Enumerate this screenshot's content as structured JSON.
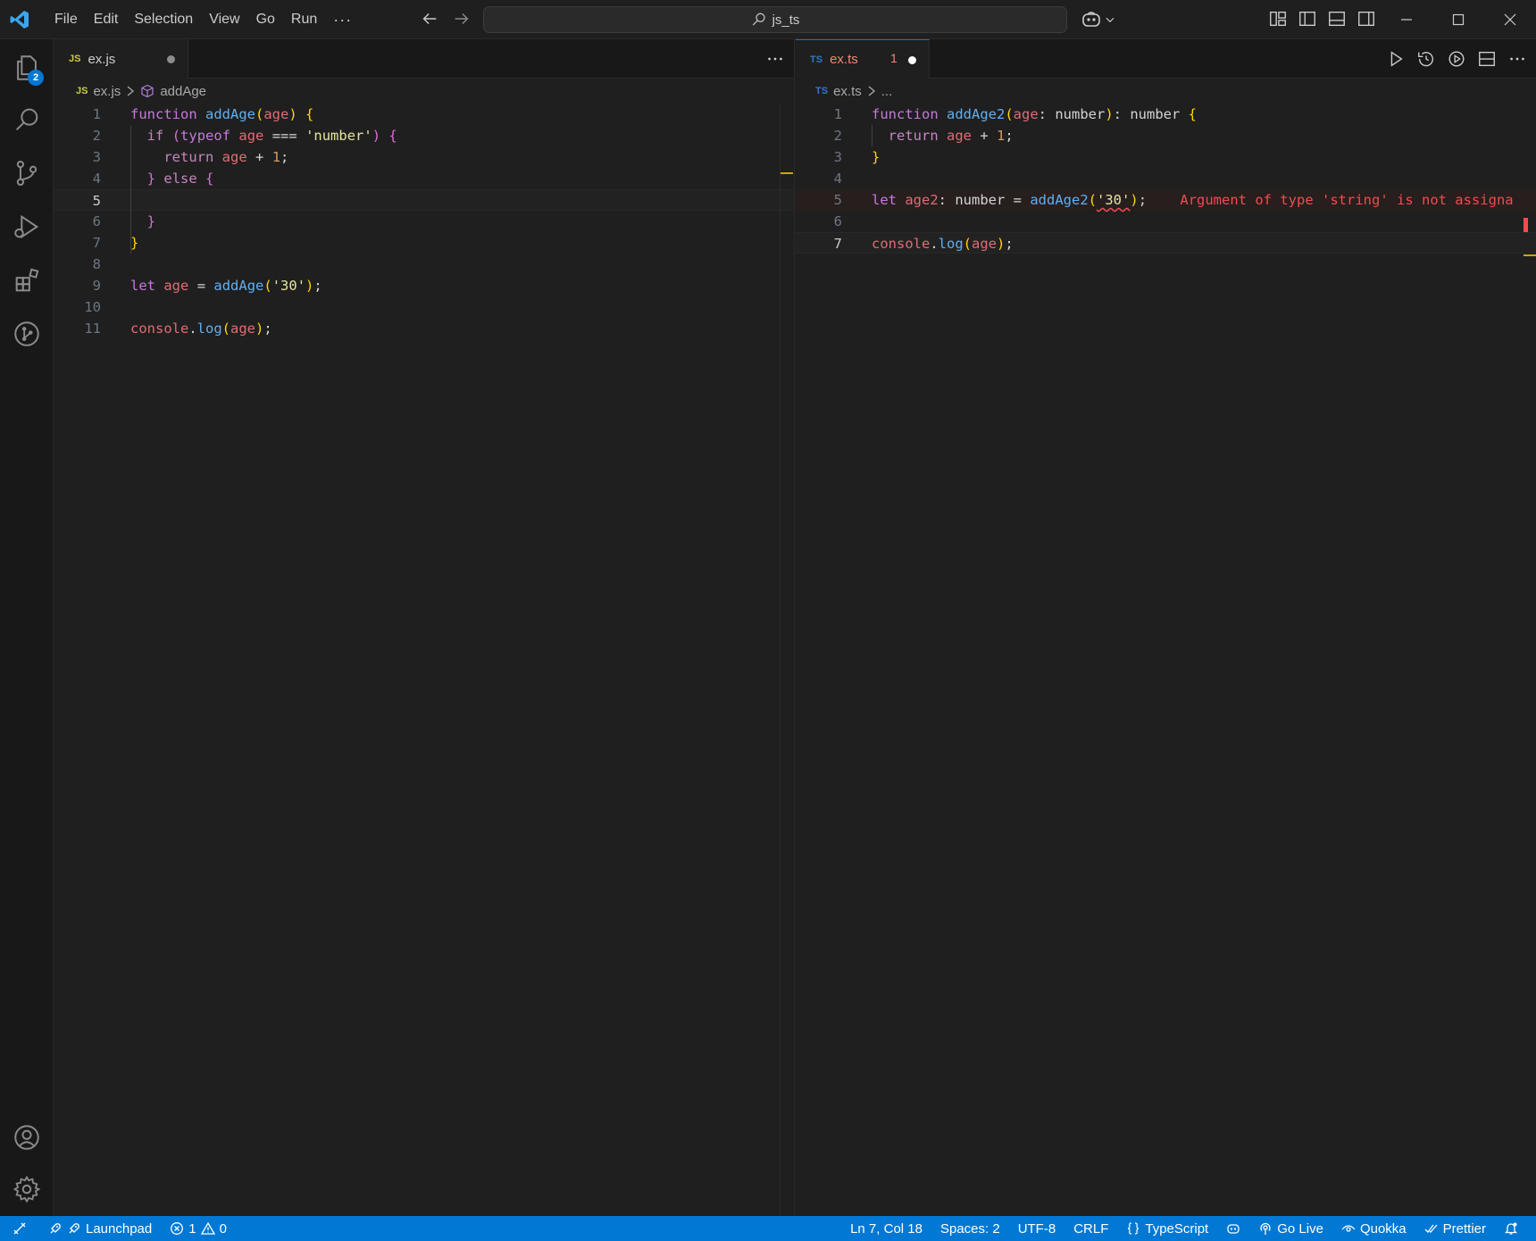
{
  "window": {
    "search_text": "js_ts",
    "menu": [
      "File",
      "Edit",
      "Selection",
      "View",
      "Go",
      "Run",
      "···"
    ]
  },
  "activity": {
    "explorer_badge": "2"
  },
  "left_editor": {
    "tab": {
      "lang": "JS",
      "name": "ex.js"
    },
    "breadcrumb": {
      "lang": "JS",
      "file": "ex.js",
      "symbol": "addAge"
    },
    "line_numbers": [
      "1",
      "2",
      "3",
      "4",
      "5",
      "6",
      "7",
      "8",
      "9",
      "10",
      "11"
    ],
    "active_line": "5"
  },
  "right_editor": {
    "tab": {
      "lang": "TS",
      "name": "ex.ts",
      "problems": "1"
    },
    "breadcrumb": {
      "lang": "TS",
      "file": "ex.ts",
      "rest": "..."
    },
    "line_numbers": [
      "1",
      "2",
      "3",
      "4",
      "5",
      "6",
      "7"
    ],
    "error_message": "Argument of type 'string' is not assigna"
  },
  "status": {
    "launchpad": "Launchpad",
    "errors": "1",
    "warnings": "0",
    "cursor": "Ln 7, Col 18",
    "spaces": "Spaces: 2",
    "encoding": "UTF-8",
    "eol": "CRLF",
    "language": "TypeScript",
    "golive": "Go Live",
    "quokka": "Quokka",
    "prettier": "Prettier"
  },
  "colors": {
    "statusbar": "#0078d4",
    "error": "#f14c4c",
    "ts_tab": "#f48771",
    "js_label": "#cbcb41",
    "ts_label": "#3178c6"
  }
}
